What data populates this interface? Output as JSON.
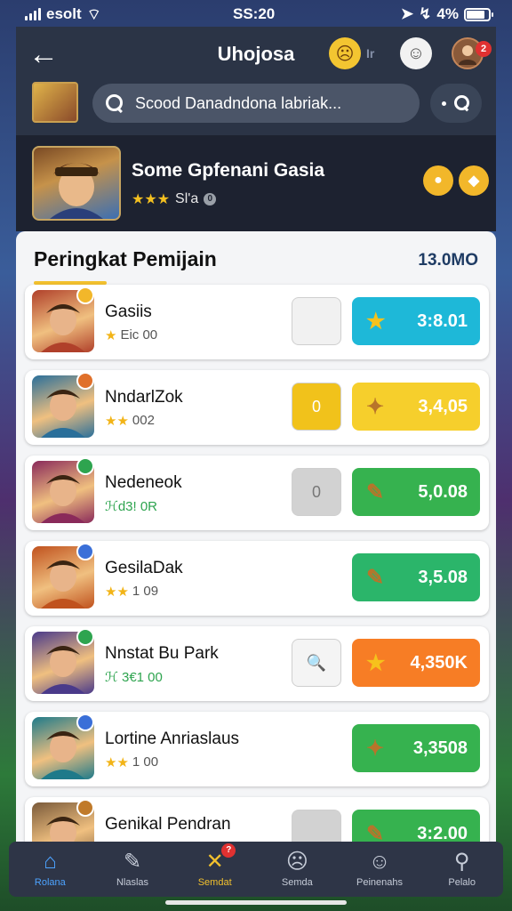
{
  "status_bar": {
    "carrier": "esolt",
    "time": "SS:20",
    "battery_text": "4%",
    "battery_level": 0.85
  },
  "header": {
    "back_icon": "←",
    "title": "Uhojosa",
    "small_label": "Ir",
    "notification_count": "2"
  },
  "search": {
    "text": "Scood Danadndona labriak..."
  },
  "featured": {
    "title": "Some Gpfenani Gasia",
    "stars": "★★★",
    "rating_text": "Sl'a"
  },
  "ranking": {
    "title": "Peringkat Pemijain",
    "count": "13.0MO",
    "players": [
      {
        "name": "Gasiis",
        "stars": "★",
        "sub": "Eic 00",
        "mid": "",
        "score": "3:8.01",
        "score_icon": "★",
        "score_color": "#1eb8d8",
        "mid_color": "#f1f1f1",
        "avatar_color": "#b0402a",
        "badge_color": "#f2b72a"
      },
      {
        "name": "NndarlZok",
        "stars": "★★",
        "sub": "002",
        "mid": "0",
        "score": "3,4,05",
        "score_icon": "✦",
        "score_color": "#f6cf2c",
        "mid_color": "#f1c21b",
        "avatar_color": "#2a6f9a",
        "badge_color": "#e0702a"
      },
      {
        "name": "Nedeneok",
        "stars": "",
        "sub": "ℋd3! 0R",
        "mid": "0",
        "score": "5,0.08",
        "score_icon": "✎",
        "score_color": "#36b24f",
        "mid_color": "#d2d2d2",
        "avatar_color": "#8a2a5a",
        "badge_color": "#2ea44f"
      },
      {
        "name": "GesilaDak",
        "stars": "★★",
        "sub": "1 09",
        "mid": "",
        "score": "3,5.08",
        "score_icon": "✎",
        "score_color": "#2bb56a",
        "mid_color": "",
        "avatar_color": "#c0521e",
        "badge_color": "#3a6fd8"
      },
      {
        "name": "Nnstat Bu Park",
        "stars": "",
        "sub": "ℋ 3€1 00",
        "mid": "🔍",
        "score": "4,350K",
        "score_icon": "★",
        "score_color": "#f77d25",
        "mid_color": "#f4f4f4",
        "avatar_color": "#4a3a8a",
        "badge_color": "#2ea44f"
      },
      {
        "name": "Lortine Anriaslaus",
        "stars": "★★",
        "sub": "1 00",
        "mid": "",
        "score": "3,3508",
        "score_icon": "✦",
        "score_color": "#36b24f",
        "mid_color": "",
        "avatar_color": "#1e7a8a",
        "badge_color": "#3a6fd8"
      },
      {
        "name": "Genikal Pendran",
        "stars": "",
        "sub": "",
        "mid": "",
        "score": "3:2.00",
        "score_icon": "✎",
        "score_color": "#36b24f",
        "mid_color": "#d2d2d2",
        "avatar_color": "#7a5a3a",
        "badge_color": "#c07a2a"
      }
    ]
  },
  "bottom_nav": [
    {
      "label": "Rolana",
      "icon": "⌂",
      "icon_name": "home-icon",
      "state": "active"
    },
    {
      "label": "Nlaslas",
      "icon": "✎",
      "icon_name": "pencil-icon",
      "state": ""
    },
    {
      "label": "Semdat",
      "icon": "✕",
      "icon_name": "crossed-swords-icon",
      "state": "special",
      "badge": "?"
    },
    {
      "label": "Semda",
      "icon": "☹",
      "icon_name": "face-icon",
      "state": ""
    },
    {
      "label": "Peinenahs",
      "icon": "☺",
      "icon_name": "chat-face-icon",
      "state": ""
    },
    {
      "label": "Pelalo",
      "icon": "⚲",
      "icon_name": "profile-icon",
      "state": ""
    }
  ]
}
